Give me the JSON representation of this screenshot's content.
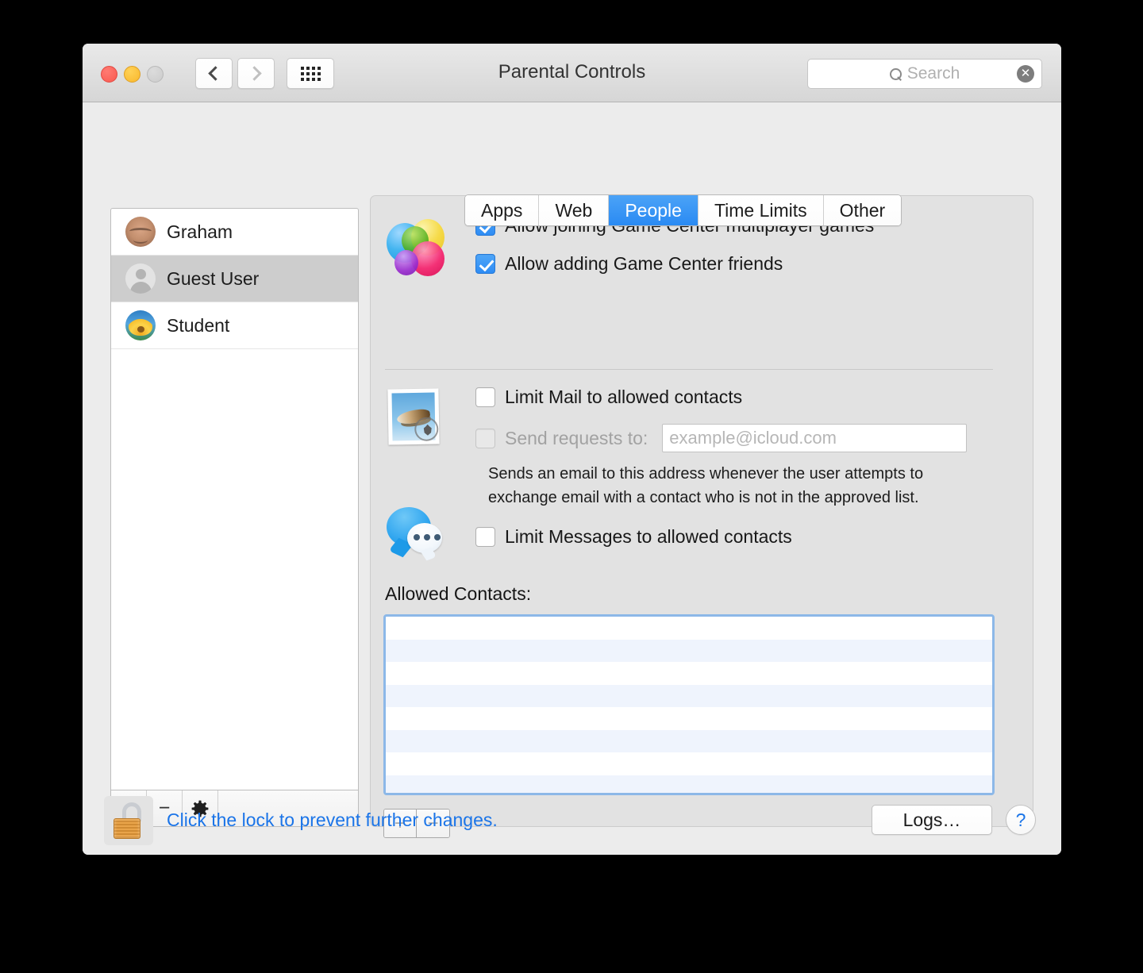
{
  "window": {
    "title": "Parental Controls",
    "traffic_lights": [
      "close",
      "minimize",
      "zoom"
    ],
    "back_icon": "chevron-left-icon",
    "forward_icon": "chevron-right-icon",
    "showall_icon": "grid-icon"
  },
  "search": {
    "placeholder": "Search",
    "value": "",
    "icon": "search-icon",
    "clear_label": "✕"
  },
  "sidebar": {
    "users": [
      {
        "name": "Graham",
        "avatar": "photo-avatar",
        "selected": false
      },
      {
        "name": "Guest User",
        "avatar": "person-silhouette-avatar",
        "selected": true
      },
      {
        "name": "Student",
        "avatar": "sunflower-avatar",
        "selected": false
      }
    ],
    "toolbar": {
      "add_label": "+",
      "remove_label": "−",
      "gear_icon": "gear-icon"
    }
  },
  "tabs": [
    {
      "label": "Apps",
      "active": false
    },
    {
      "label": "Web",
      "active": false
    },
    {
      "label": "People",
      "active": true
    },
    {
      "label": "Time Limits",
      "active": false
    },
    {
      "label": "Other",
      "active": false
    }
  ],
  "people": {
    "game_center": {
      "icon": "game-center-icon",
      "multiplayer": {
        "label": "Allow joining Game Center multiplayer games",
        "checked": true,
        "enabled": true
      },
      "friends": {
        "label": "Allow adding Game Center friends",
        "checked": true,
        "enabled": true
      }
    },
    "mail": {
      "icon": "mail-stamp-icon",
      "limit_mail": {
        "label": "Limit Mail to allowed contacts",
        "checked": false,
        "enabled": true
      },
      "send_requests": {
        "label": "Send requests to:",
        "checked": false,
        "enabled": false
      },
      "email_field": {
        "placeholder": "example@icloud.com",
        "value": "",
        "enabled": false
      },
      "help_line_1": "Sends an email to this address whenever the user attempts to",
      "help_line_2": "exchange email with a contact who is not in the approved list."
    },
    "messages": {
      "icon": "messages-icon",
      "limit_messages": {
        "label": "Limit Messages to allowed contacts",
        "checked": false,
        "enabled": true
      }
    },
    "allowed_contacts": {
      "label": "Allowed Contacts:",
      "items": [],
      "add_label": "+",
      "remove_label": "−"
    }
  },
  "footer": {
    "lock_icon": "unlocked-padlock-icon",
    "lock_text": "Click the lock to prevent further changes.",
    "logs_label": "Logs…",
    "help_label": "?"
  },
  "colors": {
    "accent": "#2e8cf4",
    "tab_active": "#2a8af3",
    "link": "#1a74e8",
    "window_bg": "#ececec",
    "panel_bg": "#e2e2e2",
    "selection": "#cdcdcd",
    "list_stripe": "#eff4fd",
    "list_focus_border": "#8cb8e8"
  }
}
